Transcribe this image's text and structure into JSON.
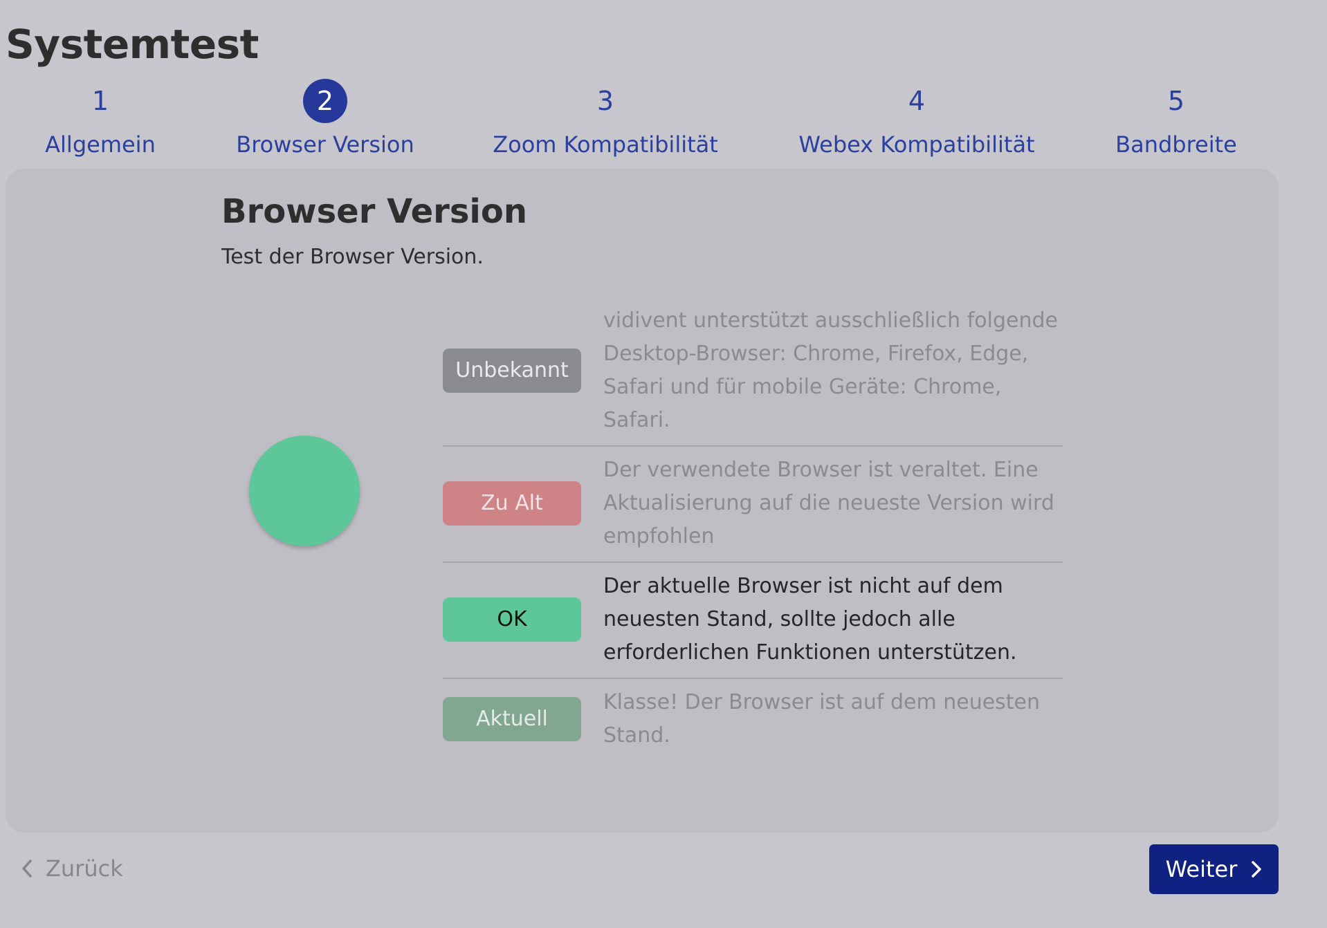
{
  "page": {
    "title": "Systemtest"
  },
  "steps": [
    {
      "number": "1",
      "label": "Allgemein",
      "active": false
    },
    {
      "number": "2",
      "label": "Browser Version",
      "active": true
    },
    {
      "number": "3",
      "label": "Zoom Kompatibilität",
      "active": false
    },
    {
      "number": "4",
      "label": "Webex Kompatibilität",
      "active": false
    },
    {
      "number": "5",
      "label": "Bandbreite",
      "active": false
    }
  ],
  "card": {
    "title": "Browser Version",
    "subtitle": "Test der Browser Version.",
    "result_color": "#5ec799"
  },
  "statuses": [
    {
      "badge": "Unbekannt",
      "badge_bg": "#8a8b8f",
      "badge_color": "#e9e9ec",
      "text": "vidivent unterstützt ausschließlich folgende Desktop-Browser: Chrome, Firefox, Edge, Safari und für mobile Geräte: Chrome, Safari.",
      "current": false
    },
    {
      "badge": "Zu Alt",
      "badge_bg": "#ce8387",
      "badge_color": "#f3e4e5",
      "text": "Der verwendete Browser ist veraltet. Eine Aktualisierung auf die neueste Version wird empfohlen",
      "current": false
    },
    {
      "badge": "OK",
      "badge_bg": "#5ec799",
      "badge_color": "#111111",
      "text": "Der aktuelle Browser ist nicht auf dem neuesten Stand, sollte jedoch alle erforderlichen Funktionen unterstützen.",
      "current": true
    },
    {
      "badge": "Aktuell",
      "badge_bg": "#82a791",
      "badge_color": "#e5ece7",
      "text": "Klasse! Der Browser ist auf dem neuesten Stand.",
      "current": false
    }
  ],
  "nav": {
    "back_label": "Zurück",
    "next_label": "Weiter",
    "primary_color": "#0f2282"
  }
}
